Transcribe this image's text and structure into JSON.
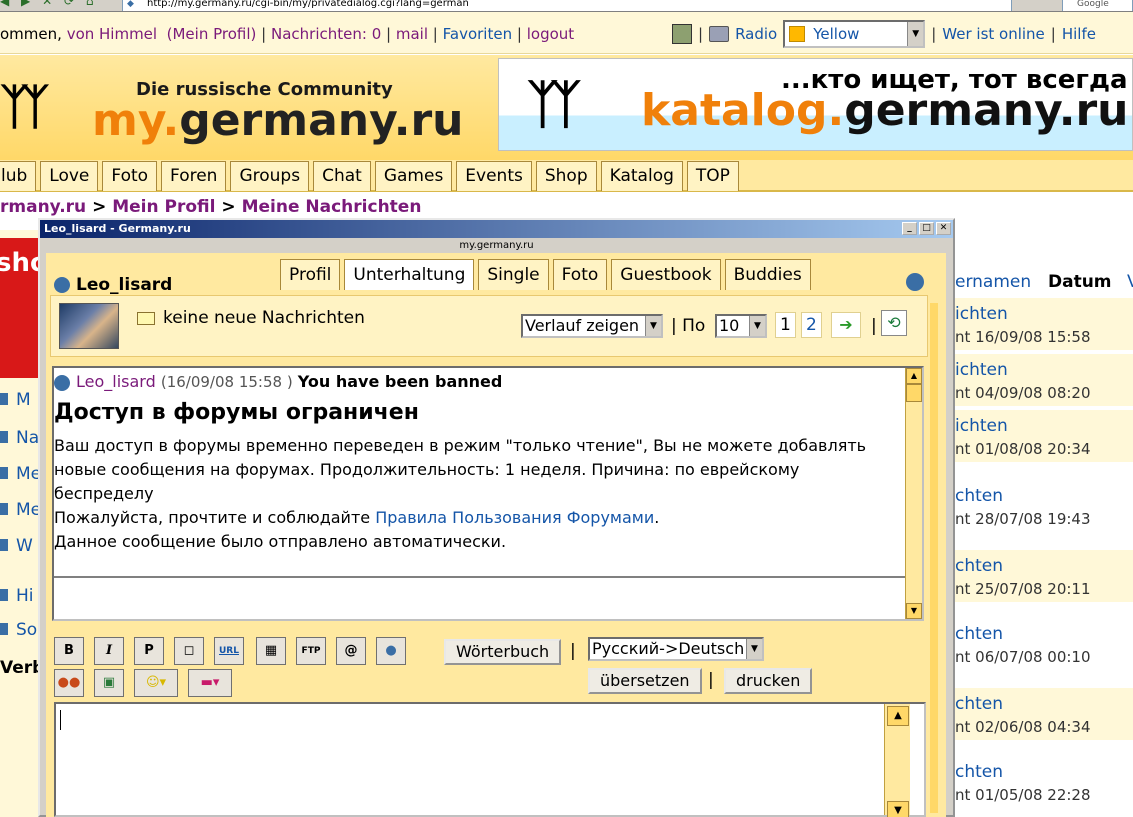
{
  "browser": {
    "url": "http://my.germany.ru/cgi-bin/my/privatedialog.cgi?lang=german",
    "search_placeholder": "Google"
  },
  "topbar": {
    "welcome_prefix": "ommen,",
    "user": "von Himmel",
    "profil_link": "(Mein Profil)",
    "nachrichten": "Nachrichten: 0",
    "mail": "mail",
    "favoriten": "Favoriten",
    "logout": "logout",
    "radio": "Radio",
    "color_select": "Yellow",
    "wer_ist_online": "Wer ist online",
    "hilfe": "Hilfe",
    "sep": "|"
  },
  "header": {
    "tagline": "Die russische Community",
    "logo_accent": "my.",
    "logo_name": "germany.ru",
    "banner_slogan": "...кто ищет, тот всегда на",
    "banner_accent": "katalog.",
    "banner_name": "germany.ru"
  },
  "nav": {
    "tabs": [
      "lub",
      "Love",
      "Foto",
      "Foren",
      "Groups",
      "Chat",
      "Games",
      "Events",
      "Shop",
      "Katalog",
      "TOP"
    ]
  },
  "breadcrumb": {
    "root": "rmany.ru",
    "sep": ">",
    "profil": "Mein Profil",
    "nachrichten": "Meine Nachrichten"
  },
  "left_side": {
    "red_text": "sho",
    "items": [
      "M",
      "Na",
      "Me",
      "Me",
      "W",
      "Hi",
      "So",
      "Verb"
    ]
  },
  "right_list": {
    "col_name": "ernamen",
    "col_date": "Datum",
    "col_extra": "V",
    "rows": [
      {
        "title": "ichten",
        "date": "nt 16/09/08 15:58"
      },
      {
        "title": "ichten",
        "date": "nt 04/09/08 08:20"
      },
      {
        "title": "ichten",
        "date": "nt 01/08/08 20:34"
      },
      {
        "title": "chten",
        "date": "nt 28/07/08 19:43"
      },
      {
        "title": "chten",
        "date": "nt 25/07/08 20:11"
      },
      {
        "title": "chten",
        "date": "nt 06/07/08 00:10"
      },
      {
        "title": "chten",
        "date": "nt 02/06/08 04:34"
      },
      {
        "title": "chten",
        "date": "nt 01/05/08 22:28"
      }
    ]
  },
  "popup": {
    "window_title": "Leo_lisard - Germany.ru",
    "inner_url": "my.germany.ru",
    "tabs": [
      "Profil",
      "Unterhaltung",
      "Single",
      "Foto",
      "Guestbook",
      "Buddies"
    ],
    "active_tab": "Unterhaltung",
    "user_name": "Leo_lisard",
    "no_messages": "keine neue Nachrichten",
    "history_select": "Verlauf zeigen",
    "per_page_label": "| По",
    "per_page_value": "10",
    "page_1": "1",
    "page_2": "2",
    "pipe": "|",
    "message": {
      "author": "Leo_lisard",
      "date": "(16/09/08 15:58 )",
      "subject": "You have been banned",
      "title": "Доступ в форумы ограничен",
      "body_1": "Ваш доступ в форумы временно переведен в режим \"только чтение\", Вы не можете добавлять",
      "body_2": "новые сообщения на форумах. Продолжительность: 1 неделя. Причина: по еврейскому",
      "body_3": "беспределу",
      "body_4": "Пожалуйста, прочтите и соблюдайте",
      "rules_link": "Правила Пользования Форумами",
      "body_4_end": ".",
      "body_5": "Данное сообщение было отправлено автоматически."
    },
    "toolbar": {
      "bold": "B",
      "italic": "I",
      "p": "P",
      "url": "URL",
      "ftp": "FTP",
      "at": "@",
      "woerterbuch": "Wörterbuch",
      "lang_select": "Русский->Deutsch",
      "uebersetzen": "übersetzen",
      "drucken": "drucken"
    }
  }
}
